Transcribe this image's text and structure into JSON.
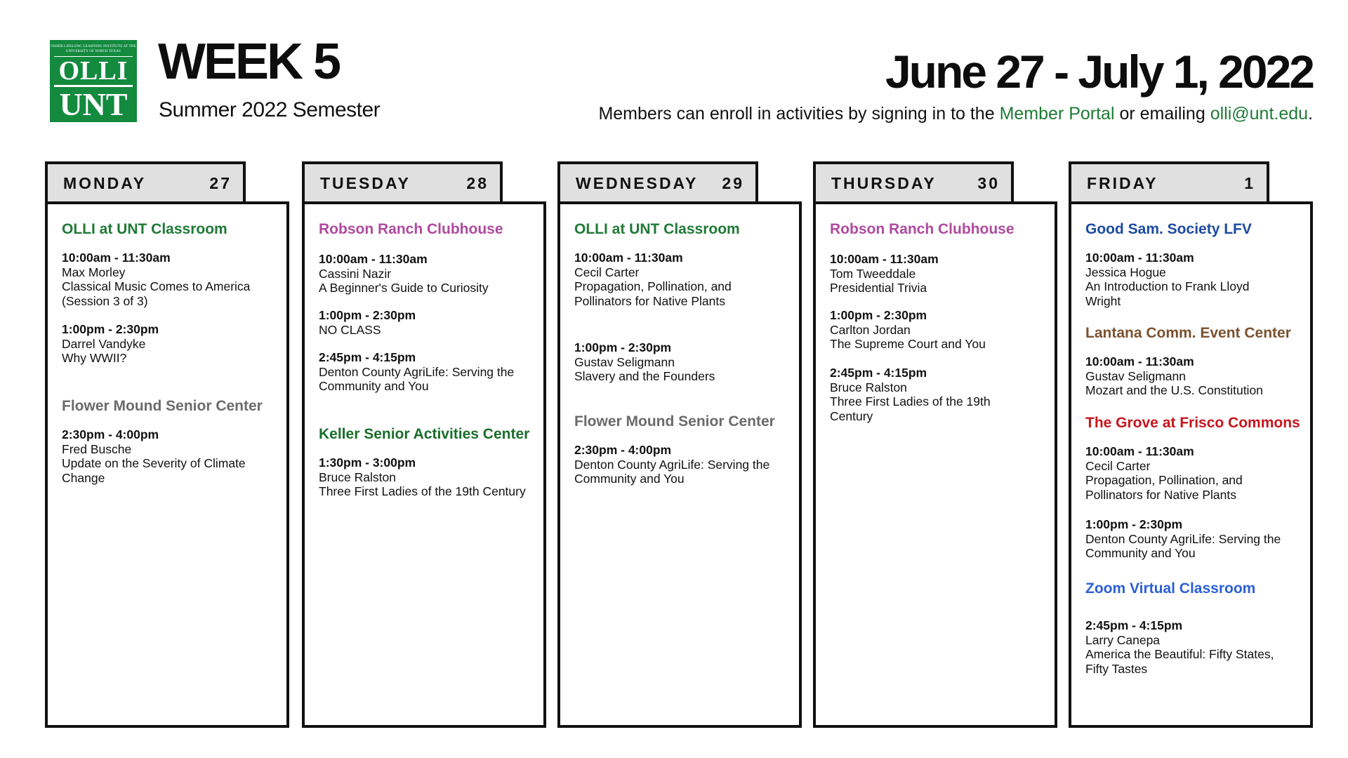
{
  "logo": {
    "top_text": "OSHER LIFELONG LEARNING INSTITUTE AT THE UNIVERSITY OF NORTH TEXAS",
    "olli": "OLLI",
    "unt": "UNT"
  },
  "header": {
    "week": "WEEK 5",
    "semester": "Summer 2022 Semester",
    "date_range": "June 27 - July 1, 2022",
    "enroll_prefix": "Members can enroll in activities by signing in to the ",
    "portal_link": "Member Portal",
    "enroll_mid": " or emailing ",
    "email_link": "olli@unt.edu",
    "enroll_suffix": "."
  },
  "colors": {
    "olli_green": "#1f7a36",
    "robson_purple": "#b04a9e",
    "flower_gray": "#6b6b6b",
    "keller_green": "#1a6e2a",
    "goodsam_blue": "#1c4aa0",
    "lantana_brown": "#7a5230",
    "grove_red": "#c8161d",
    "zoom_blue": "#2b5fd6"
  },
  "days": [
    {
      "name": "MONDAY",
      "date": "27",
      "locations": [
        {
          "name": "OLLI at UNT Classroom",
          "sessions": [
            {
              "time": "10:00am - 11:30am",
              "lines": [
                "Max Morley",
                "Classical Music Comes to America",
                "(Session 3 of 3)"
              ]
            },
            {
              "time": "1:00pm - 2:30pm",
              "lines": [
                "Darrel Vandyke",
                "Why WWII?"
              ]
            }
          ]
        },
        {
          "name": "Flower Mound Senior Center",
          "sessions": [
            {
              "time": "2:30pm - 4:00pm",
              "lines": [
                "Fred Busche",
                "Update on the Severity of Climate",
                "Change"
              ]
            }
          ]
        }
      ]
    },
    {
      "name": "TUESDAY",
      "date": "28",
      "locations": [
        {
          "name": "Robson Ranch Clubhouse",
          "sessions": [
            {
              "time": "10:00am - 11:30am",
              "lines": [
                "Cassini Nazir",
                "A Beginner's Guide to Curiosity"
              ]
            },
            {
              "time": "1:00pm - 2:30pm",
              "lines": [
                "NO CLASS"
              ]
            },
            {
              "time": "2:45pm - 4:15pm",
              "lines": [
                "Denton County AgriLife: Serving the",
                "Community and You"
              ]
            }
          ]
        },
        {
          "name": "Keller Senior Activities Center",
          "sessions": [
            {
              "time": "1:30pm - 3:00pm",
              "lines": [
                "Bruce Ralston",
                "Three First Ladies of the 19th Century"
              ]
            }
          ]
        }
      ]
    },
    {
      "name": "WEDNESDAY",
      "date": "29",
      "locations": [
        {
          "name": "OLLI at UNT Classroom",
          "sessions": [
            {
              "time": "10:00am - 11:30am",
              "lines": [
                "Cecil Carter",
                "Propagation, Pollination, and",
                "Pollinators for Native Plants"
              ]
            },
            {
              "time": "1:00pm - 2:30pm",
              "lines": [
                "Gustav Seligmann",
                "Slavery and the Founders"
              ]
            }
          ]
        },
        {
          "name": "Flower Mound Senior Center",
          "sessions": [
            {
              "time": "2:30pm - 4:00pm",
              "lines": [
                "Denton County AgriLife: Serving the",
                "Community and You"
              ]
            }
          ]
        }
      ]
    },
    {
      "name": "THURSDAY",
      "date": "30",
      "locations": [
        {
          "name": "Robson Ranch Clubhouse",
          "sessions": [
            {
              "time": "10:00am - 11:30am",
              "lines": [
                "Tom Tweeddale",
                "Presidential Trivia"
              ]
            },
            {
              "time": "1:00pm - 2:30pm",
              "lines": [
                "Carlton Jordan",
                "The Supreme Court and You"
              ]
            },
            {
              "time": "2:45pm - 4:15pm",
              "lines": [
                "Bruce Ralston",
                "Three First Ladies of the 19th",
                "Century"
              ]
            }
          ]
        }
      ]
    },
    {
      "name": "FRIDAY",
      "date": "1",
      "locations": [
        {
          "name": "Good Sam. Society LFV",
          "sessions": [
            {
              "time": "10:00am - 11:30am",
              "lines": [
                "Jessica Hogue",
                "An Introduction to Frank Lloyd",
                "Wright"
              ]
            }
          ]
        },
        {
          "name": "Lantana Comm. Event Center",
          "sessions": [
            {
              "time": "10:00am - 11:30am",
              "lines": [
                "Gustav Seligmann",
                "Mozart and the U.S. Constitution"
              ]
            }
          ]
        },
        {
          "name": "The Grove at Frisco Commons",
          "sessions": [
            {
              "time": "10:00am - 11:30am",
              "lines": [
                "Cecil Carter",
                "Propagation, Pollination, and",
                "Pollinators for Native Plants"
              ]
            },
            {
              "time": "1:00pm - 2:30pm",
              "lines": [
                "Denton County AgriLife: Serving the",
                "Community and You"
              ]
            }
          ]
        },
        {
          "name": "Zoom Virtual Classroom",
          "sessions": [
            {
              "time": "2:45pm - 4:15pm",
              "lines": [
                "Larry Canepa",
                "America the Beautiful: Fifty States,",
                "Fifty Tastes"
              ]
            }
          ]
        }
      ]
    }
  ]
}
